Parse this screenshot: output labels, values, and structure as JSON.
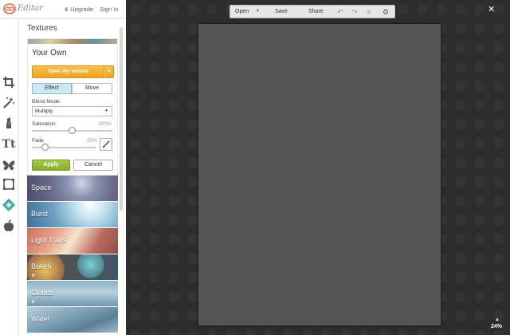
{
  "app": {
    "logo_text": "Editor"
  },
  "topbar": {
    "upgrade_label": "Upgrade",
    "signin_label": "Sign In"
  },
  "rail": {
    "tools": [
      "crop-icon",
      "magic-wand-icon",
      "lipstick-icon",
      "text-icon",
      "butterfly-icon",
      "frame-icon",
      "texture-icon",
      "apple-icon"
    ],
    "text_tool_glyph": "Tt"
  },
  "panel": {
    "title": "Textures",
    "your_own": {
      "title": "Your Own",
      "open_button": "Open my texture",
      "tabs": [
        "Effect",
        "Move"
      ],
      "blend_label": "Blend Mode:",
      "blend_value": "Multiply",
      "saturation_label": "Saturation",
      "saturation_value": "100%",
      "saturation_level": 0.5,
      "fade_label": "Fade",
      "fade_value": "20%",
      "fade_level": 0.2,
      "apply_label": "Apply",
      "cancel_label": "Cancel"
    },
    "textures": [
      {
        "label": "Space",
        "premium": false
      },
      {
        "label": "Burst",
        "premium": false
      },
      {
        "label": "Light Trails",
        "premium": false
      },
      {
        "label": "Bokeh",
        "premium": true
      },
      {
        "label": "Clouds",
        "premium": true
      },
      {
        "label": "Water",
        "premium": false
      }
    ]
  },
  "toolbar": {
    "open_label": "Open",
    "save_label": "Save",
    "share_label": "Share"
  },
  "status": {
    "zoom": "24%"
  },
  "colors": {
    "accent_orange": "#eca421",
    "apply_green": "#86ad2b",
    "canvas_gray": "#555555",
    "workspace_dark": "#2d2d2d"
  }
}
